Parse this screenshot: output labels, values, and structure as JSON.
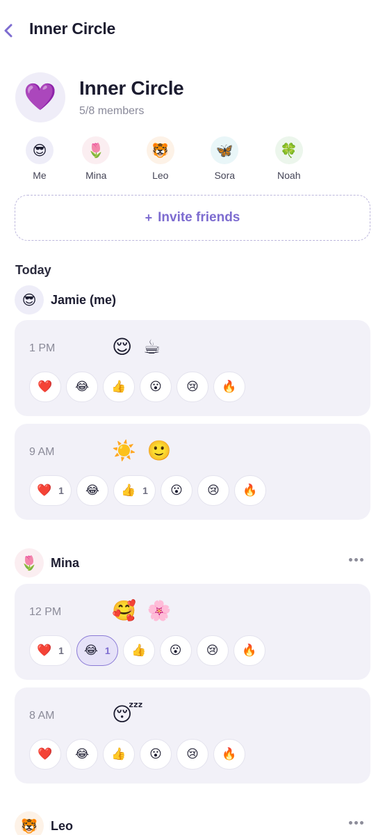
{
  "header": {
    "title": "Inner Circle",
    "back_icon": "chevron-left-icon"
  },
  "group": {
    "emoji": "💜",
    "name": "Inner Circle",
    "members_text": "5/8 members"
  },
  "members": [
    {
      "name": "Me",
      "emoji": "😎",
      "bg": "#eeedf8"
    },
    {
      "name": "Mina",
      "emoji": "🌷",
      "bg": "#fbeef1"
    },
    {
      "name": "Leo",
      "emoji": "🐯",
      "bg": "#fdf2e7"
    },
    {
      "name": "Sora",
      "emoji": "🦋",
      "bg": "#e9f6f8"
    },
    {
      "name": "Noah",
      "emoji": "🍀",
      "bg": "#ecf6ec"
    }
  ],
  "invite": {
    "plus": "+",
    "label": "Invite friends"
  },
  "section": {
    "today": "Today"
  },
  "users": [
    {
      "name": "Jamie (me)",
      "emoji": "😎",
      "bg": "#eeedf8",
      "has_more": false,
      "posts": [
        {
          "time": "1 PM",
          "emojis": "😌 ☕",
          "reactions": [
            {
              "emoji": "❤️",
              "count": ""
            },
            {
              "emoji": "😂",
              "count": ""
            },
            {
              "emoji": "👍",
              "count": ""
            },
            {
              "emoji": "😮",
              "count": ""
            },
            {
              "emoji": "😢",
              "count": ""
            },
            {
              "emoji": "🔥",
              "count": ""
            }
          ]
        },
        {
          "time": "9 AM",
          "emojis": "☀️ 🙂",
          "reactions": [
            {
              "emoji": "❤️",
              "count": "1"
            },
            {
              "emoji": "😂",
              "count": ""
            },
            {
              "emoji": "👍",
              "count": "1"
            },
            {
              "emoji": "😮",
              "count": ""
            },
            {
              "emoji": "😢",
              "count": ""
            },
            {
              "emoji": "🔥",
              "count": ""
            }
          ]
        }
      ]
    },
    {
      "name": "Mina",
      "emoji": "🌷",
      "bg": "#fbeef1",
      "has_more": true,
      "posts": [
        {
          "time": "12 PM",
          "emojis": "🥰 🌸",
          "reactions": [
            {
              "emoji": "❤️",
              "count": "1"
            },
            {
              "emoji": "😂",
              "count": "1",
              "active": true
            },
            {
              "emoji": "👍",
              "count": ""
            },
            {
              "emoji": "😮",
              "count": ""
            },
            {
              "emoji": "😢",
              "count": ""
            },
            {
              "emoji": "🔥",
              "count": ""
            }
          ]
        },
        {
          "time": "8 AM",
          "emojis": "😴",
          "reactions": [
            {
              "emoji": "❤️",
              "count": ""
            },
            {
              "emoji": "😂",
              "count": ""
            },
            {
              "emoji": "👍",
              "count": ""
            },
            {
              "emoji": "😮",
              "count": ""
            },
            {
              "emoji": "😢",
              "count": ""
            },
            {
              "emoji": "🔥",
              "count": ""
            }
          ]
        }
      ]
    },
    {
      "name": "Leo",
      "emoji": "🐯",
      "bg": "#fdf2e7",
      "has_more": true,
      "posts": []
    }
  ],
  "colors": {
    "accent": "#7d6cd0",
    "card_bg": "#f2f1f8",
    "text": "#1c1c30",
    "muted": "#8a8a98"
  }
}
